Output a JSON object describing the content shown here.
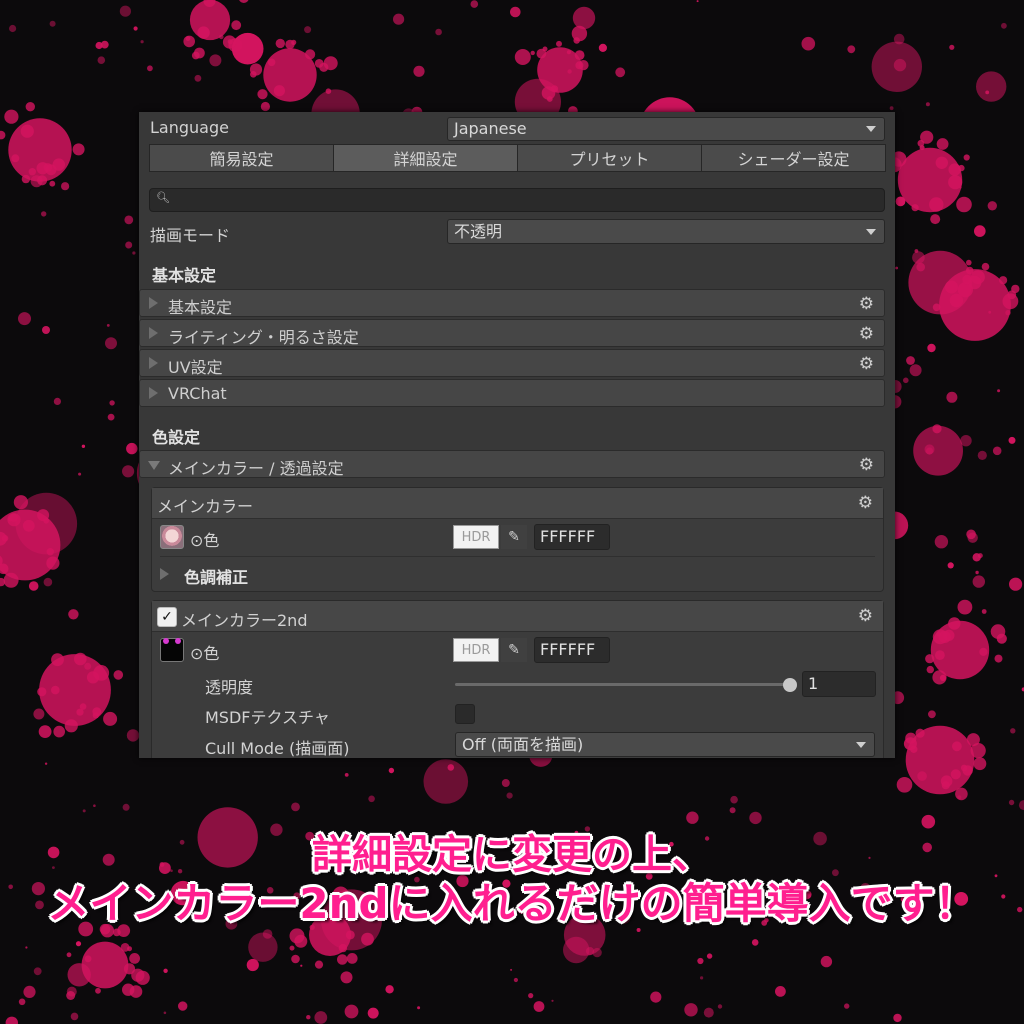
{
  "language": {
    "label": "Language",
    "value": "Japanese"
  },
  "tabs": [
    {
      "label": "簡易設定"
    },
    {
      "label": "詳細設定"
    },
    {
      "label": "プリセット"
    },
    {
      "label": "シェーダー設定"
    }
  ],
  "active_tab": "詳細設定",
  "render_mode": {
    "label": "描画モード",
    "value": "不透明"
  },
  "section_basic": {
    "title": "基本設定",
    "foldouts": [
      {
        "label": "基本設定",
        "has_gear": true
      },
      {
        "label": "ライティング・明るさ設定",
        "has_gear": true
      },
      {
        "label": "UV設定",
        "has_gear": true
      },
      {
        "label": "VRChat",
        "has_gear": false
      }
    ]
  },
  "section_color": {
    "title": "色設定",
    "foldout": {
      "label": "メインカラー / 透過設定",
      "expanded": true
    },
    "main_color": {
      "title": "メインカラー",
      "color_label": "⊙色",
      "hdr_label": "HDR",
      "hex_value": "FFFFFF",
      "sub_foldout": "色調補正"
    },
    "main_color_2nd": {
      "title": "メインカラー2nd",
      "checked": true,
      "color_label": "⊙色",
      "hdr_label": "HDR",
      "hex_value": "FFFFFF",
      "opacity_label": "透明度",
      "opacity_value": "1",
      "opacity_fraction": 1,
      "msdf_label": "MSDFテクスチャ",
      "msdf_checked": false,
      "cull_label": "Cull Mode (描画面)",
      "cull_value": "Off (両面を描画)"
    }
  },
  "caption": {
    "line1": "詳細設定に変更の上、",
    "line2": "メインカラー2ndに入れるだけの簡単導入です！"
  },
  "colors": {
    "accent": "#ff1f8f",
    "splatter": "#d4145f",
    "background": "#0c0a0c",
    "panel": "#383838"
  },
  "icons": {
    "gear": "gear-icon",
    "search": "search-icon",
    "eyedropper": "eyedropper-icon",
    "dropdown": "chevron-down-icon",
    "foldout": "triangle-right-icon"
  }
}
